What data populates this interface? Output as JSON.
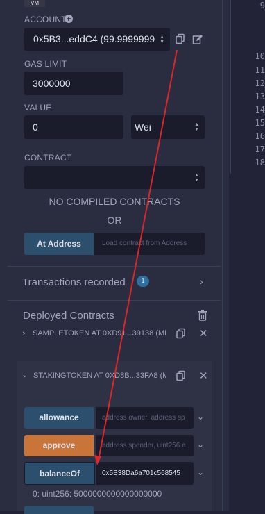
{
  "env_tag": "VM",
  "account": {
    "label": "ACCOUNT",
    "value": "0x5B3...eddC4 (99.9999999"
  },
  "gas_limit": {
    "label": "GAS LIMIT",
    "value": "3000000"
  },
  "value": {
    "label": "VALUE",
    "amount": "0",
    "unit": "Wei"
  },
  "contract": {
    "label": "CONTRACT",
    "value": ""
  },
  "no_compiled": "NO COMPILED CONTRACTS",
  "or_text": "OR",
  "at_address": {
    "button": "At Address",
    "placeholder": "Load contract from Address"
  },
  "transactions": {
    "title": "Transactions recorded",
    "count": "1"
  },
  "deployed": {
    "title": "Deployed Contracts",
    "contracts": [
      {
        "name": "SAMPLETOKEN AT 0XD91...39138 (MI"
      },
      {
        "name": "STAKINGTOKEN AT 0XD8B...33FA8 (M"
      }
    ]
  },
  "functions": [
    {
      "label": "allowance",
      "placeholder": "address owner, address sp",
      "value": ""
    },
    {
      "label": "approve",
      "placeholder": "address spender, uint256 a",
      "value": ""
    },
    {
      "label": "balanceOf",
      "placeholder": "",
      "value": "0x5B38Da6a701c568545"
    }
  ],
  "result": "0: uint256: 5000000000000000000",
  "line_numbers": [
    "9",
    "10",
    "11",
    "12",
    "13",
    "14",
    "15",
    "16",
    "17",
    "18"
  ],
  "colors": {
    "bg": "#2a2c3f",
    "input": "#1a1b2b",
    "blue_button": "#2c4f6d",
    "orange_button": "#c97539",
    "badge": "#2e6f9f",
    "arrow": "#d8282b"
  },
  "icons": [
    "plus-circle-icon",
    "copy-icon",
    "edit-icon",
    "chevron-right-icon",
    "trash-icon",
    "close-icon",
    "chevron-down-icon",
    "select-arrows-icon"
  ]
}
